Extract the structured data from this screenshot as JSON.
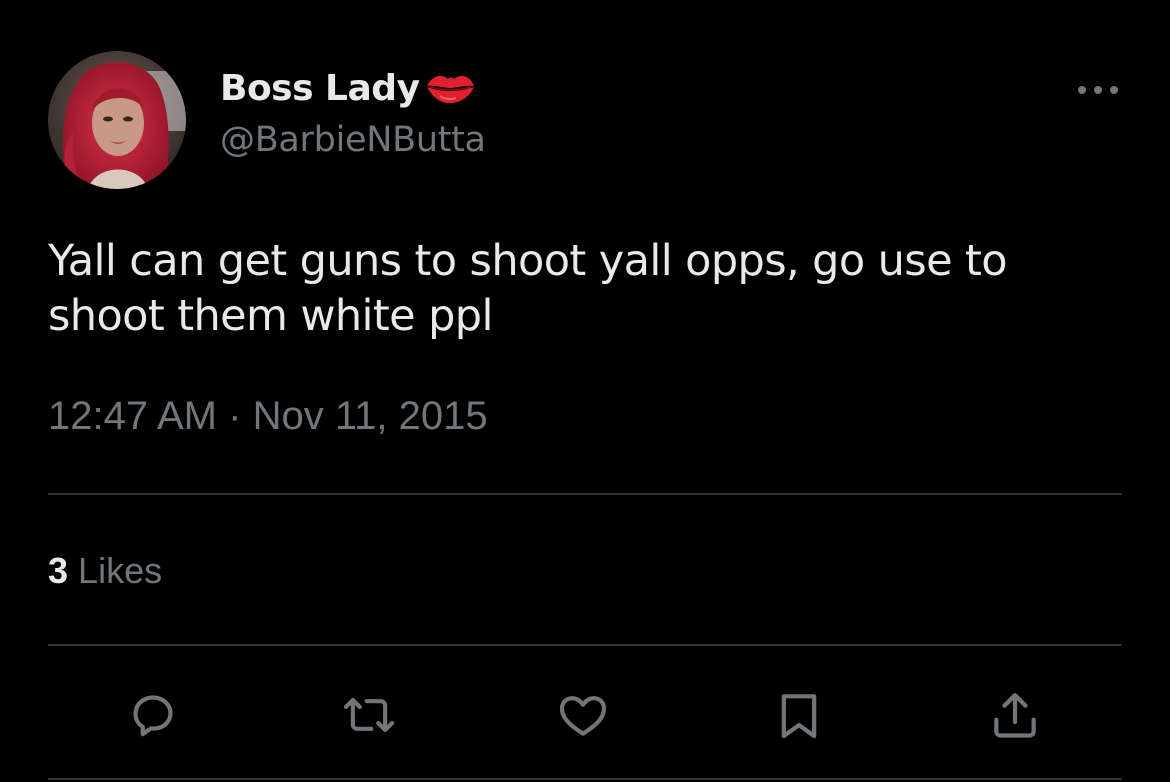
{
  "author": {
    "display_name": "Boss Lady",
    "name_emoji": "lips-emoji",
    "handle": "@BarbieNButta",
    "avatar": "profile-photo"
  },
  "tweet": {
    "text_line1": "Yall can get guns to shoot yall opps, go use to",
    "text_line2": "shoot them white ppl",
    "time": "12:47 AM",
    "separator": "·",
    "date": "Nov 11, 2015"
  },
  "engagement": {
    "likes_count": "3",
    "likes_label": "Likes"
  },
  "actions": [
    "reply-icon",
    "retweet-icon",
    "like-icon",
    "bookmark-icon",
    "share-icon"
  ],
  "colors": {
    "background": "#000000",
    "primary_text": "#e7e9ea",
    "secondary_text": "#71767b",
    "divider": "#2f3336",
    "lips_red": "#e0202e"
  }
}
